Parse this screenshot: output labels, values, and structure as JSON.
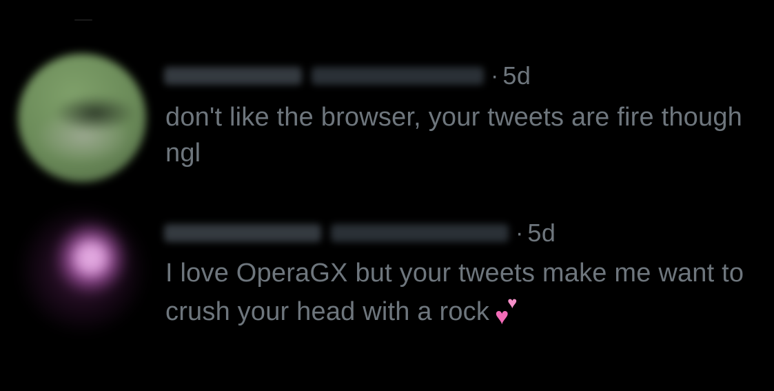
{
  "replies": [
    {
      "avatar_icon": "avatar-blurred-green",
      "time_separator": "·",
      "time": "5d",
      "text": "don't like the browser, your tweets are fire though ngl",
      "emoji": ""
    },
    {
      "avatar_icon": "avatar-blurred-pink",
      "time_separator": "·",
      "time": "5d",
      "text": "I love OperaGX but your tweets make me want to crush your head with a rock",
      "emoji": "two-hearts-icon"
    }
  ],
  "colors": {
    "background": "#000000",
    "secondary_text": "#6e767d",
    "emoji_pink": "#f26bb7"
  }
}
